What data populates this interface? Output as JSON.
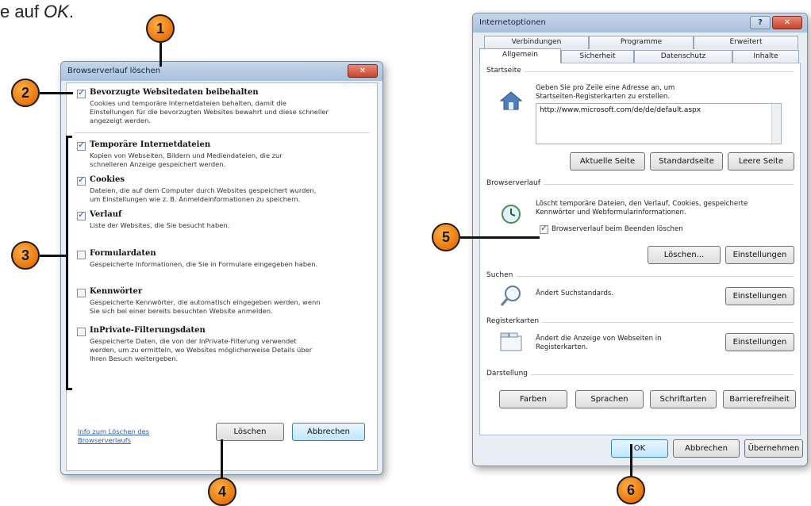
{
  "caption": {
    "prefix": "e auf ",
    "ok": "OK",
    "suffix": "."
  },
  "left_dialog": {
    "title": "Browserverlauf löschen",
    "close_glyph": "✕",
    "options": [
      {
        "title": "Bevorzugte Websitedaten beibehalten",
        "checked": true,
        "desc": [
          "Cookies und temporäre Internetdateien behalten, damit die",
          "Einstellungen für die bevorzugten Websites bewahrt und diese schneller",
          "angezeigt werden."
        ]
      },
      {
        "title": "Temporäre Internetdateien",
        "checked": true,
        "desc": [
          "Kopien von Webseiten, Bildern und Mediendateien, die zur",
          "schnelleren Anzeige gespeichert werden."
        ]
      },
      {
        "title": "Cookies",
        "checked": true,
        "desc": [
          "Dateien, die auf dem Computer durch Websites gespeichert wurden,",
          "um Einstellungen wie z. B. Anmeldeinformationen zu speichern."
        ]
      },
      {
        "title": "Verlauf",
        "checked": true,
        "desc": [
          "Liste der Websites, die Sie besucht haben."
        ]
      },
      {
        "title": "Formulardaten",
        "checked": false,
        "desc": [
          "Gespeicherte Informationen, die Sie in Formulare eingegeben haben."
        ]
      },
      {
        "title": "Kennwörter",
        "checked": false,
        "desc": [
          "Gespeicherte Kennwörter, die automatisch eingegeben werden, wenn",
          "Sie sich bei einer bereits besuchten Website anmelden."
        ]
      },
      {
        "title": "InPrivate-Filterungsdaten",
        "checked": false,
        "desc": [
          "Gespeicherte Daten, die von der InPrivate-Filterung verwendet",
          "werden, um zu ermitteln, wo Websites möglicherweise Details über",
          "Ihren Besuch weitergeben."
        ]
      }
    ],
    "info_link": [
      "Info zum Löschen des",
      "Browserverlaufs"
    ],
    "delete_label": "Löschen",
    "cancel_label": "Abbrechen"
  },
  "right_dialog": {
    "title": "Internetoptionen",
    "help_glyph": "?",
    "close_glyph": "✕",
    "tabs_row1": [
      "Verbindungen",
      "Programme",
      "Erweitert"
    ],
    "tabs_row2": [
      "Allgemein",
      "Sicherheit",
      "Datenschutz",
      "Inhalte"
    ],
    "startseite": {
      "label": "Startseite",
      "text": [
        "Geben Sie pro Zeile eine Adresse an, um",
        "Startseiten-Registerkarten zu erstellen."
      ],
      "url": "http://www.microsoft.com/de/de/default.aspx",
      "buttons": [
        "Aktuelle Seite",
        "Standardseite",
        "Leere Seite"
      ]
    },
    "browserverlauf": {
      "label": "Browserverlauf",
      "text": [
        "Löscht temporäre Dateien, den Verlauf, Cookies, gespeicherte",
        "Kennwörter und Webformularinformationen."
      ],
      "checkbox_label": "Browserverlauf beim Beenden löschen",
      "checked": true,
      "delete_label": "Löschen...",
      "settings_label": "Einstellungen"
    },
    "suchen": {
      "label": "Suchen",
      "text": "Ändert Suchstandards.",
      "settings_label": "Einstellungen"
    },
    "registerkarten": {
      "label": "Registerkarten",
      "text": [
        "Ändert die Anzeige von Webseiten in",
        "Registerkarten."
      ],
      "settings_label": "Einstellungen"
    },
    "darstellung": {
      "label": "Darstellung",
      "buttons": [
        "Farben",
        "Sprachen",
        "Schriftarten",
        "Barrierefreiheit"
      ]
    },
    "ok_label": "OK",
    "cancel_label": "Abbrechen",
    "apply_label": "Übernehmen"
  },
  "callouts": [
    "1",
    "2",
    "3",
    "4",
    "5",
    "6"
  ],
  "colors": {
    "callout": "#e8750a",
    "accent_link": "#2a5ab5",
    "title_bar": "#a9c0dc"
  }
}
